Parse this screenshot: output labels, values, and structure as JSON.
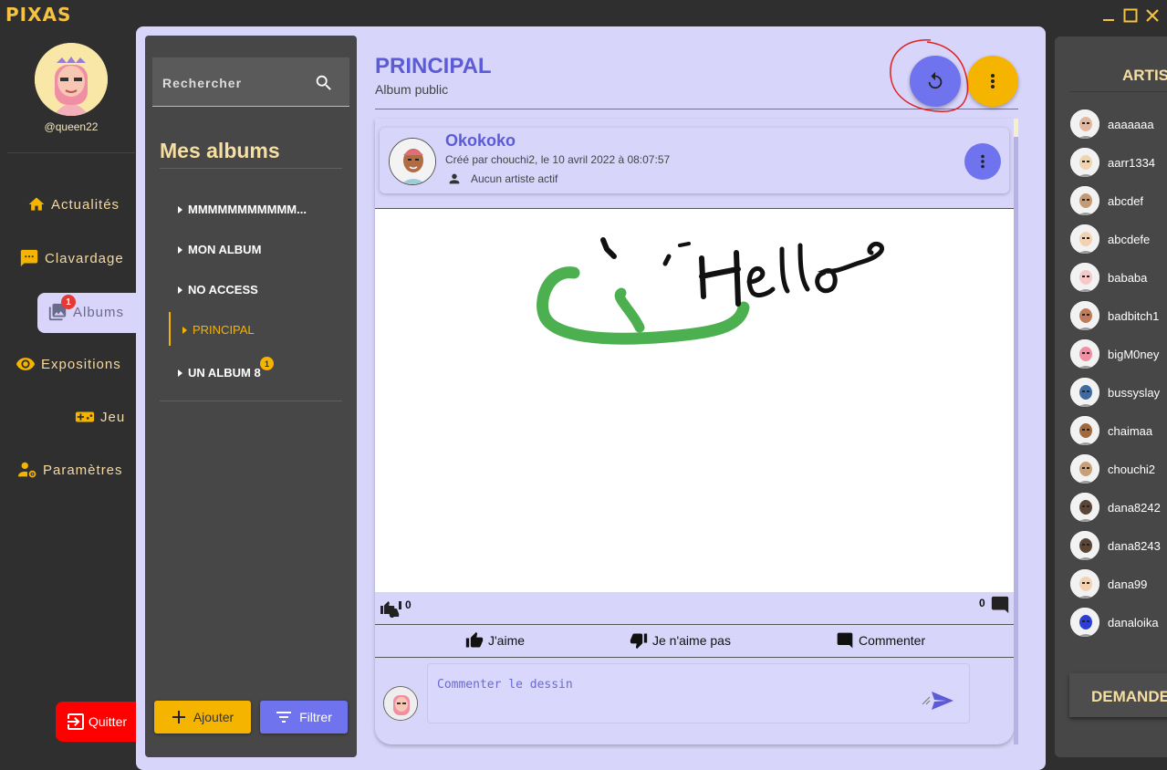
{
  "app": {
    "title": "PIXAS"
  },
  "user": {
    "username": "@queen22"
  },
  "nav": {
    "items": [
      {
        "label": "Actualités",
        "icon": "home-icon"
      },
      {
        "label": "Clavardage",
        "icon": "chat-icon"
      },
      {
        "label": "Albums",
        "icon": "photo-library-icon",
        "badge": "1"
      },
      {
        "label": "Expositions",
        "icon": "eye-icon"
      },
      {
        "label": "Jeu",
        "icon": "gamepad-icon"
      },
      {
        "label": "Paramètres",
        "icon": "user-settings-icon"
      }
    ],
    "quit_label": "Quitter"
  },
  "albums_panel": {
    "search_placeholder": "Rechercher",
    "title": "Mes albums",
    "items": [
      {
        "label": "MMMMMMMMMMM..."
      },
      {
        "label": "MON ALBUM"
      },
      {
        "label": "NO ACCESS"
      },
      {
        "label": "PRINCIPAL",
        "active": true
      },
      {
        "label": "UN ALBUM 8",
        "badge": "1"
      }
    ],
    "add_label": "Ajouter",
    "filter_label": "Filtrer"
  },
  "album": {
    "title": "PRINCIPAL",
    "subtitle": "Album public"
  },
  "drawing": {
    "name": "Okokoko",
    "meta": "Créé par chouchi2, le 10 avril 2022 à 08:07:57",
    "artists": "Aucun artiste actif",
    "likes_count": "0",
    "comments_count": "0",
    "like_label": "J'aime",
    "dislike_label": "Je n'aime pas",
    "comment_label": "Commenter",
    "comment_placeholder": "Commenter le dessin"
  },
  "artists_panel": {
    "title": "ARTISTES",
    "artists": [
      "aaaaaaa",
      "aarr1334",
      "abcdef",
      "abcdefe",
      "bababa",
      "badbitch1",
      "bigM0ney",
      "bussyslay",
      "chaimaa",
      "chouchi2",
      "dana8242",
      "dana8243",
      "dana99",
      "danaloika"
    ],
    "demandes_label": "DEMANDES"
  },
  "colors": {
    "accent": "#7073ee",
    "brand": "#f5b400",
    "title": "#5b5bd6",
    "panel": "#474747",
    "surface": "#d8d5fb"
  }
}
